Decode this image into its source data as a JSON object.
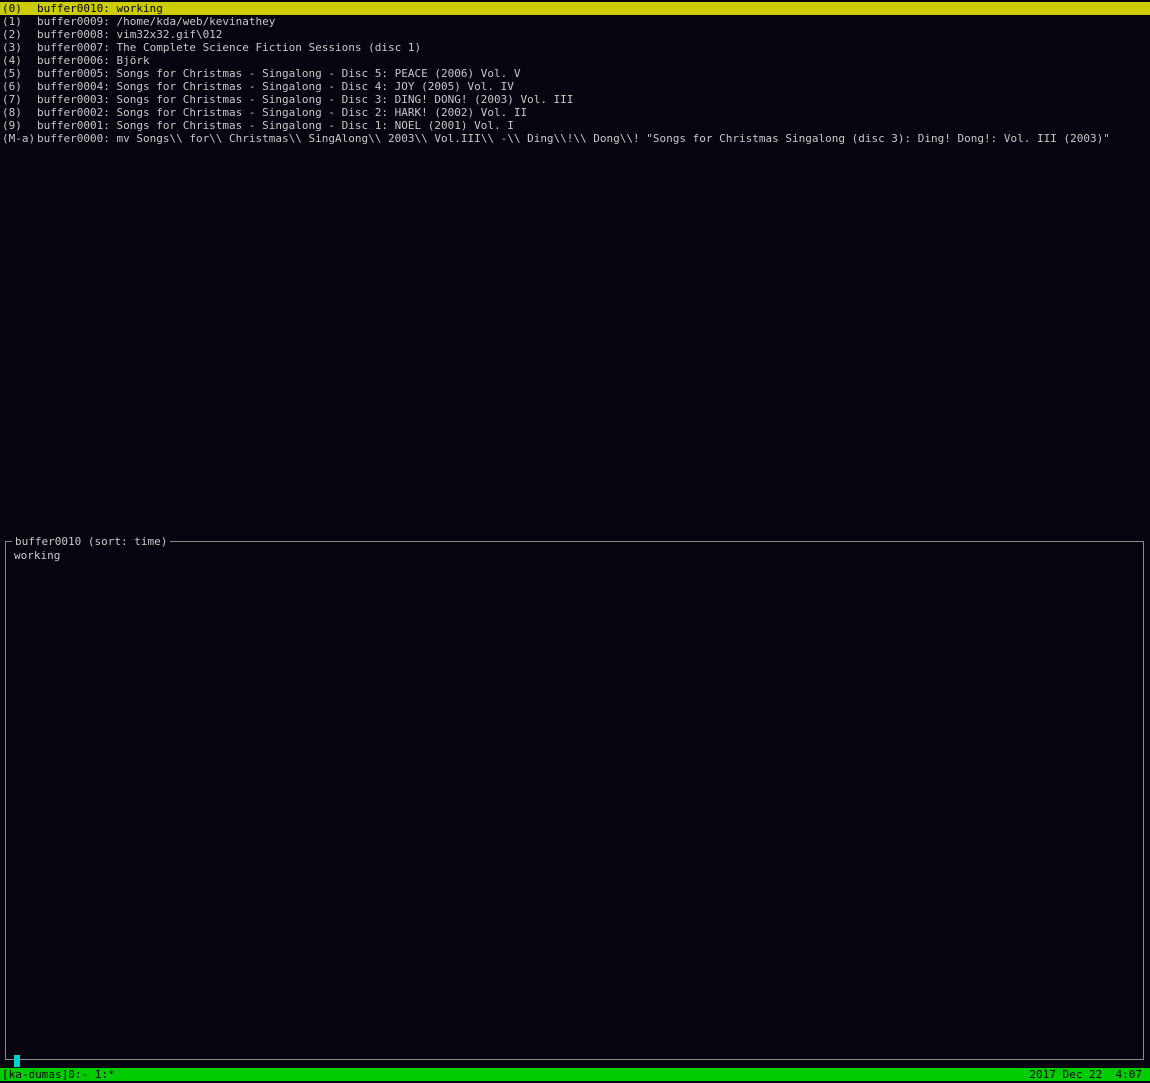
{
  "buffer_list": [
    {
      "key": "(0)",
      "name": "buffer0010",
      "content": "working"
    },
    {
      "key": "(1)",
      "name": "buffer0009",
      "content": "/home/kda/web/kevinathey"
    },
    {
      "key": "(2)",
      "name": "buffer0008",
      "content": "vim32x32.gif\\012"
    },
    {
      "key": "(3)",
      "name": "buffer0007",
      "content": "The Complete Science Fiction Sessions (disc 1)"
    },
    {
      "key": "(4)",
      "name": "buffer0006",
      "content": "Björk"
    },
    {
      "key": "(5)",
      "name": "buffer0005",
      "content": "Songs for Christmas - Singalong - Disc 5: PEACE (2006) Vol. V"
    },
    {
      "key": "(6)",
      "name": "buffer0004",
      "content": "Songs for Christmas - Singalong - Disc 4: JOY (2005) Vol. IV"
    },
    {
      "key": "(7)",
      "name": "buffer0003",
      "content": "Songs for Christmas - Singalong - Disc 3: DING! DONG! (2003) Vol. III"
    },
    {
      "key": "(8)",
      "name": "buffer0002",
      "content": "Songs for Christmas - Singalong - Disc 2: HARK! (2002) Vol. II"
    },
    {
      "key": "(9)",
      "name": "buffer0001",
      "content": "Songs for Christmas - Singalong - Disc 1: NOEL (2001) Vol. I"
    },
    {
      "key": "(M-a)",
      "name": "buffer0000",
      "content": "mv Songs\\\\ for\\\\ Christmas\\\\ SingAlong\\\\ 2003\\\\ Vol.III\\\\ -\\\\ Ding\\\\!\\\\ Dong\\\\! \"Songs for Christmas Singalong (disc 3): Ding! Dong!: Vol. III (2003)\""
    }
  ],
  "row_text": [
    "buffer0010: working",
    "buffer0009: /home/kda/web/kevinathey",
    "buffer0008: vim32x32.gif\\012",
    "buffer0007: The Complete Science Fiction Sessions (disc 1)",
    "buffer0006: Björk",
    "buffer0005: Songs for Christmas - Singalong - Disc 5: PEACE (2006) Vol. V",
    "buffer0004: Songs for Christmas - Singalong - Disc 4: JOY (2005) Vol. IV",
    "buffer0003: Songs for Christmas - Singalong - Disc 3: DING! DONG! (2003) Vol. III",
    "buffer0002: Songs for Christmas - Singalong - Disc 2: HARK! (2002) Vol. II",
    "buffer0001: Songs for Christmas - Singalong - Disc 1: NOEL (2001) Vol. I",
    "buffer0000: mv Songs\\\\ for\\\\ Christmas\\\\ SingAlong\\\\ 2003\\\\ Vol.III\\\\ -\\\\ Ding\\\\!\\\\ Dong\\\\! \"Songs for Christmas Singalong (disc 3): Ding! Dong!: Vol. III (2003)\""
  ],
  "preview": {
    "title": "buffer0010 (sort: time)",
    "content": "working"
  },
  "statusbar": {
    "left": "[ka-dumas]0:- 1:*",
    "right": "2017 Dec 22  4:07"
  },
  "colors": {
    "background": "#05050f",
    "selection": "#cccc00",
    "statusbar": "#00cc00",
    "cursor": "#00d0d0",
    "text": "#c8c8c8"
  }
}
